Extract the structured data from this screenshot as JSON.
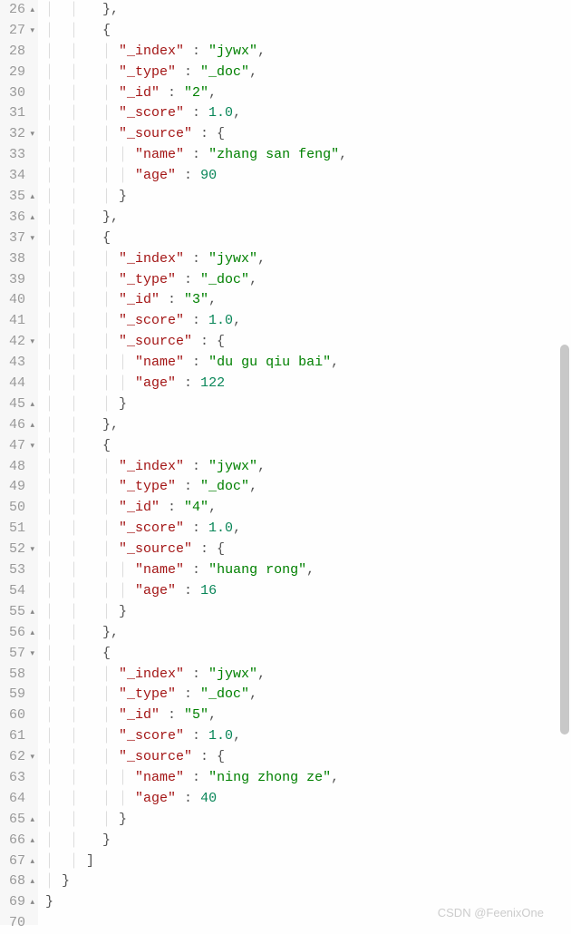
{
  "watermark": "CSDN @FeenixOne",
  "lines": [
    {
      "num": "26",
      "marker": "▴",
      "tokens": [
        {
          "t": "guide",
          "v": "│  │   "
        },
        {
          "t": "punct",
          "v": "},"
        }
      ]
    },
    {
      "num": "27",
      "marker": "▾",
      "tokens": [
        {
          "t": "guide",
          "v": "│  │   "
        },
        {
          "t": "punct",
          "v": "{"
        }
      ]
    },
    {
      "num": "28",
      "marker": "",
      "tokens": [
        {
          "t": "guide",
          "v": "│  │   │ "
        },
        {
          "t": "key",
          "v": "\"_index\""
        },
        {
          "t": "punct",
          "v": " : "
        },
        {
          "t": "str",
          "v": "\"jywx\""
        },
        {
          "t": "punct",
          "v": ","
        }
      ]
    },
    {
      "num": "29",
      "marker": "",
      "tokens": [
        {
          "t": "guide",
          "v": "│  │   │ "
        },
        {
          "t": "key",
          "v": "\"_type\""
        },
        {
          "t": "punct",
          "v": " : "
        },
        {
          "t": "str",
          "v": "\"_doc\""
        },
        {
          "t": "punct",
          "v": ","
        }
      ]
    },
    {
      "num": "30",
      "marker": "",
      "tokens": [
        {
          "t": "guide",
          "v": "│  │   │ "
        },
        {
          "t": "key",
          "v": "\"_id\""
        },
        {
          "t": "punct",
          "v": " : "
        },
        {
          "t": "str",
          "v": "\"2\""
        },
        {
          "t": "punct",
          "v": ","
        }
      ]
    },
    {
      "num": "31",
      "marker": "",
      "tokens": [
        {
          "t": "guide",
          "v": "│  │   │ "
        },
        {
          "t": "key",
          "v": "\"_score\""
        },
        {
          "t": "punct",
          "v": " : "
        },
        {
          "t": "num",
          "v": "1.0"
        },
        {
          "t": "punct",
          "v": ","
        }
      ]
    },
    {
      "num": "32",
      "marker": "▾",
      "tokens": [
        {
          "t": "guide",
          "v": "│  │   │ "
        },
        {
          "t": "key",
          "v": "\"_source\""
        },
        {
          "t": "punct",
          "v": " : {"
        }
      ]
    },
    {
      "num": "33",
      "marker": "",
      "tokens": [
        {
          "t": "guide",
          "v": "│  │   │ │ "
        },
        {
          "t": "key",
          "v": "\"name\""
        },
        {
          "t": "punct",
          "v": " : "
        },
        {
          "t": "str",
          "v": "\"zhang san feng\""
        },
        {
          "t": "punct",
          "v": ","
        }
      ]
    },
    {
      "num": "34",
      "marker": "",
      "tokens": [
        {
          "t": "guide",
          "v": "│  │   │ │ "
        },
        {
          "t": "key",
          "v": "\"age\""
        },
        {
          "t": "punct",
          "v": " : "
        },
        {
          "t": "num",
          "v": "90"
        }
      ]
    },
    {
      "num": "35",
      "marker": "▴",
      "tokens": [
        {
          "t": "guide",
          "v": "│  │   │ "
        },
        {
          "t": "punct",
          "v": "}"
        }
      ]
    },
    {
      "num": "36",
      "marker": "▴",
      "tokens": [
        {
          "t": "guide",
          "v": "│  │   "
        },
        {
          "t": "punct",
          "v": "},"
        }
      ]
    },
    {
      "num": "37",
      "marker": "▾",
      "tokens": [
        {
          "t": "guide",
          "v": "│  │   "
        },
        {
          "t": "punct",
          "v": "{"
        }
      ]
    },
    {
      "num": "38",
      "marker": "",
      "tokens": [
        {
          "t": "guide",
          "v": "│  │   │ "
        },
        {
          "t": "key",
          "v": "\"_index\""
        },
        {
          "t": "punct",
          "v": " : "
        },
        {
          "t": "str",
          "v": "\"jywx\""
        },
        {
          "t": "punct",
          "v": ","
        }
      ]
    },
    {
      "num": "39",
      "marker": "",
      "tokens": [
        {
          "t": "guide",
          "v": "│  │   │ "
        },
        {
          "t": "key",
          "v": "\"_type\""
        },
        {
          "t": "punct",
          "v": " : "
        },
        {
          "t": "str",
          "v": "\"_doc\""
        },
        {
          "t": "punct",
          "v": ","
        }
      ]
    },
    {
      "num": "40",
      "marker": "",
      "tokens": [
        {
          "t": "guide",
          "v": "│  │   │ "
        },
        {
          "t": "key",
          "v": "\"_id\""
        },
        {
          "t": "punct",
          "v": " : "
        },
        {
          "t": "str",
          "v": "\"3\""
        },
        {
          "t": "punct",
          "v": ","
        }
      ]
    },
    {
      "num": "41",
      "marker": "",
      "tokens": [
        {
          "t": "guide",
          "v": "│  │   │ "
        },
        {
          "t": "key",
          "v": "\"_score\""
        },
        {
          "t": "punct",
          "v": " : "
        },
        {
          "t": "num",
          "v": "1.0"
        },
        {
          "t": "punct",
          "v": ","
        }
      ]
    },
    {
      "num": "42",
      "marker": "▾",
      "tokens": [
        {
          "t": "guide",
          "v": "│  │   │ "
        },
        {
          "t": "key",
          "v": "\"_source\""
        },
        {
          "t": "punct",
          "v": " : {"
        }
      ]
    },
    {
      "num": "43",
      "marker": "",
      "tokens": [
        {
          "t": "guide",
          "v": "│  │   │ │ "
        },
        {
          "t": "key",
          "v": "\"name\""
        },
        {
          "t": "punct",
          "v": " : "
        },
        {
          "t": "str",
          "v": "\"du gu qiu bai\""
        },
        {
          "t": "punct",
          "v": ","
        }
      ]
    },
    {
      "num": "44",
      "marker": "",
      "tokens": [
        {
          "t": "guide",
          "v": "│  │   │ │ "
        },
        {
          "t": "key",
          "v": "\"age\""
        },
        {
          "t": "punct",
          "v": " : "
        },
        {
          "t": "num",
          "v": "122"
        }
      ]
    },
    {
      "num": "45",
      "marker": "▴",
      "tokens": [
        {
          "t": "guide",
          "v": "│  │   │ "
        },
        {
          "t": "punct",
          "v": "}"
        }
      ]
    },
    {
      "num": "46",
      "marker": "▴",
      "tokens": [
        {
          "t": "guide",
          "v": "│  │   "
        },
        {
          "t": "punct",
          "v": "},"
        }
      ]
    },
    {
      "num": "47",
      "marker": "▾",
      "tokens": [
        {
          "t": "guide",
          "v": "│  │   "
        },
        {
          "t": "punct",
          "v": "{"
        }
      ]
    },
    {
      "num": "48",
      "marker": "",
      "tokens": [
        {
          "t": "guide",
          "v": "│  │   │ "
        },
        {
          "t": "key",
          "v": "\"_index\""
        },
        {
          "t": "punct",
          "v": " : "
        },
        {
          "t": "str",
          "v": "\"jywx\""
        },
        {
          "t": "punct",
          "v": ","
        }
      ]
    },
    {
      "num": "49",
      "marker": "",
      "tokens": [
        {
          "t": "guide",
          "v": "│  │   │ "
        },
        {
          "t": "key",
          "v": "\"_type\""
        },
        {
          "t": "punct",
          "v": " : "
        },
        {
          "t": "str",
          "v": "\"_doc\""
        },
        {
          "t": "punct",
          "v": ","
        }
      ]
    },
    {
      "num": "50",
      "marker": "",
      "tokens": [
        {
          "t": "guide",
          "v": "│  │   │ "
        },
        {
          "t": "key",
          "v": "\"_id\""
        },
        {
          "t": "punct",
          "v": " : "
        },
        {
          "t": "str",
          "v": "\"4\""
        },
        {
          "t": "punct",
          "v": ","
        }
      ]
    },
    {
      "num": "51",
      "marker": "",
      "tokens": [
        {
          "t": "guide",
          "v": "│  │   │ "
        },
        {
          "t": "key",
          "v": "\"_score\""
        },
        {
          "t": "punct",
          "v": " : "
        },
        {
          "t": "num",
          "v": "1.0"
        },
        {
          "t": "punct",
          "v": ","
        }
      ]
    },
    {
      "num": "52",
      "marker": "▾",
      "tokens": [
        {
          "t": "guide",
          "v": "│  │   │ "
        },
        {
          "t": "key",
          "v": "\"_source\""
        },
        {
          "t": "punct",
          "v": " : {"
        }
      ]
    },
    {
      "num": "53",
      "marker": "",
      "tokens": [
        {
          "t": "guide",
          "v": "│  │   │ │ "
        },
        {
          "t": "key",
          "v": "\"name\""
        },
        {
          "t": "punct",
          "v": " : "
        },
        {
          "t": "str",
          "v": "\"huang rong\""
        },
        {
          "t": "punct",
          "v": ","
        }
      ]
    },
    {
      "num": "54",
      "marker": "",
      "tokens": [
        {
          "t": "guide",
          "v": "│  │   │ │ "
        },
        {
          "t": "key",
          "v": "\"age\""
        },
        {
          "t": "punct",
          "v": " : "
        },
        {
          "t": "num",
          "v": "16"
        }
      ]
    },
    {
      "num": "55",
      "marker": "▴",
      "tokens": [
        {
          "t": "guide",
          "v": "│  │   │ "
        },
        {
          "t": "punct",
          "v": "}"
        }
      ]
    },
    {
      "num": "56",
      "marker": "▴",
      "tokens": [
        {
          "t": "guide",
          "v": "│  │   "
        },
        {
          "t": "punct",
          "v": "},"
        }
      ]
    },
    {
      "num": "57",
      "marker": "▾",
      "tokens": [
        {
          "t": "guide",
          "v": "│  │   "
        },
        {
          "t": "punct",
          "v": "{"
        }
      ]
    },
    {
      "num": "58",
      "marker": "",
      "tokens": [
        {
          "t": "guide",
          "v": "│  │   │ "
        },
        {
          "t": "key",
          "v": "\"_index\""
        },
        {
          "t": "punct",
          "v": " : "
        },
        {
          "t": "str",
          "v": "\"jywx\""
        },
        {
          "t": "punct",
          "v": ","
        }
      ]
    },
    {
      "num": "59",
      "marker": "",
      "tokens": [
        {
          "t": "guide",
          "v": "│  │   │ "
        },
        {
          "t": "key",
          "v": "\"_type\""
        },
        {
          "t": "punct",
          "v": " : "
        },
        {
          "t": "str",
          "v": "\"_doc\""
        },
        {
          "t": "punct",
          "v": ","
        }
      ]
    },
    {
      "num": "60",
      "marker": "",
      "tokens": [
        {
          "t": "guide",
          "v": "│  │   │ "
        },
        {
          "t": "key",
          "v": "\"_id\""
        },
        {
          "t": "punct",
          "v": " : "
        },
        {
          "t": "str",
          "v": "\"5\""
        },
        {
          "t": "punct",
          "v": ","
        }
      ]
    },
    {
      "num": "61",
      "marker": "",
      "tokens": [
        {
          "t": "guide",
          "v": "│  │   │ "
        },
        {
          "t": "key",
          "v": "\"_score\""
        },
        {
          "t": "punct",
          "v": " : "
        },
        {
          "t": "num",
          "v": "1.0"
        },
        {
          "t": "punct",
          "v": ","
        }
      ]
    },
    {
      "num": "62",
      "marker": "▾",
      "tokens": [
        {
          "t": "guide",
          "v": "│  │   │ "
        },
        {
          "t": "key",
          "v": "\"_source\""
        },
        {
          "t": "punct",
          "v": " : {"
        }
      ]
    },
    {
      "num": "63",
      "marker": "",
      "tokens": [
        {
          "t": "guide",
          "v": "│  │   │ │ "
        },
        {
          "t": "key",
          "v": "\"name\""
        },
        {
          "t": "punct",
          "v": " : "
        },
        {
          "t": "str",
          "v": "\"ning zhong ze\""
        },
        {
          "t": "punct",
          "v": ","
        }
      ]
    },
    {
      "num": "64",
      "marker": "",
      "tokens": [
        {
          "t": "guide",
          "v": "│  │   │ │ "
        },
        {
          "t": "key",
          "v": "\"age\""
        },
        {
          "t": "punct",
          "v": " : "
        },
        {
          "t": "num",
          "v": "40"
        }
      ]
    },
    {
      "num": "65",
      "marker": "▴",
      "tokens": [
        {
          "t": "guide",
          "v": "│  │   │ "
        },
        {
          "t": "punct",
          "v": "}"
        }
      ]
    },
    {
      "num": "66",
      "marker": "▴",
      "tokens": [
        {
          "t": "guide",
          "v": "│  │   "
        },
        {
          "t": "punct",
          "v": "}"
        }
      ]
    },
    {
      "num": "67",
      "marker": "▴",
      "tokens": [
        {
          "t": "guide",
          "v": "│  │ "
        },
        {
          "t": "punct",
          "v": "]"
        }
      ]
    },
    {
      "num": "68",
      "marker": "▴",
      "tokens": [
        {
          "t": "guide",
          "v": "│ "
        },
        {
          "t": "punct",
          "v": "}"
        }
      ]
    },
    {
      "num": "69",
      "marker": "▴",
      "tokens": [
        {
          "t": "punct",
          "v": "}"
        }
      ]
    },
    {
      "num": "70",
      "marker": "",
      "tokens": []
    }
  ]
}
